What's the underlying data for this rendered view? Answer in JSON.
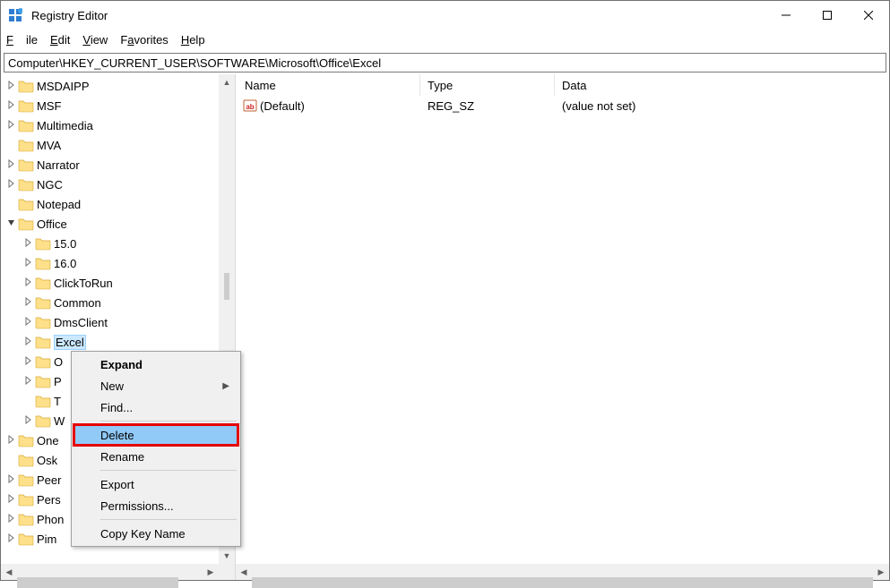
{
  "window": {
    "title": "Registry Editor"
  },
  "menu": {
    "file": "File",
    "edit": "Edit",
    "view": "View",
    "favorites": "Favorites",
    "help": "Help"
  },
  "address": "Computer\\HKEY_CURRENT_USER\\SOFTWARE\\Microsoft\\Office\\Excel",
  "tree": {
    "items": [
      {
        "label": "MSDAIPP",
        "depth": 1,
        "arrow": ">"
      },
      {
        "label": "MSF",
        "depth": 1,
        "arrow": ">"
      },
      {
        "label": "Multimedia",
        "depth": 1,
        "arrow": ">"
      },
      {
        "label": "MVA",
        "depth": 1,
        "arrow": ""
      },
      {
        "label": "Narrator",
        "depth": 1,
        "arrow": ">"
      },
      {
        "label": "NGC",
        "depth": 1,
        "arrow": ">"
      },
      {
        "label": "Notepad",
        "depth": 1,
        "arrow": ""
      },
      {
        "label": "Office",
        "depth": 1,
        "arrow": "v"
      },
      {
        "label": "15.0",
        "depth": 2,
        "arrow": ">"
      },
      {
        "label": "16.0",
        "depth": 2,
        "arrow": ">"
      },
      {
        "label": "ClickToRun",
        "depth": 2,
        "arrow": ">"
      },
      {
        "label": "Common",
        "depth": 2,
        "arrow": ">"
      },
      {
        "label": "DmsClient",
        "depth": 2,
        "arrow": ">"
      },
      {
        "label": "Excel",
        "depth": 2,
        "arrow": ">",
        "selected": true
      },
      {
        "label": "O",
        "depth": 2,
        "arrow": ">"
      },
      {
        "label": "P",
        "depth": 2,
        "arrow": ">"
      },
      {
        "label": "T",
        "depth": 2,
        "arrow": ""
      },
      {
        "label": "W",
        "depth": 2,
        "arrow": ">"
      },
      {
        "label": "One",
        "depth": 1,
        "arrow": ">"
      },
      {
        "label": "Osk",
        "depth": 1,
        "arrow": ""
      },
      {
        "label": "Peer",
        "depth": 1,
        "arrow": ">"
      },
      {
        "label": "Pers",
        "depth": 1,
        "arrow": ">"
      },
      {
        "label": "Phon",
        "depth": 1,
        "arrow": ">"
      },
      {
        "label": "Pim",
        "depth": 1,
        "arrow": ">"
      }
    ]
  },
  "columns": {
    "name": "Name",
    "type": "Type",
    "data": "Data"
  },
  "values": [
    {
      "name": "(Default)",
      "type": "REG_SZ",
      "data": "(value not set)"
    }
  ],
  "context_menu": {
    "expand": "Expand",
    "new": "New",
    "find": "Find...",
    "delete": "Delete",
    "rename": "Rename",
    "export": "Export",
    "permissions": "Permissions...",
    "copy_key_name": "Copy Key Name"
  }
}
